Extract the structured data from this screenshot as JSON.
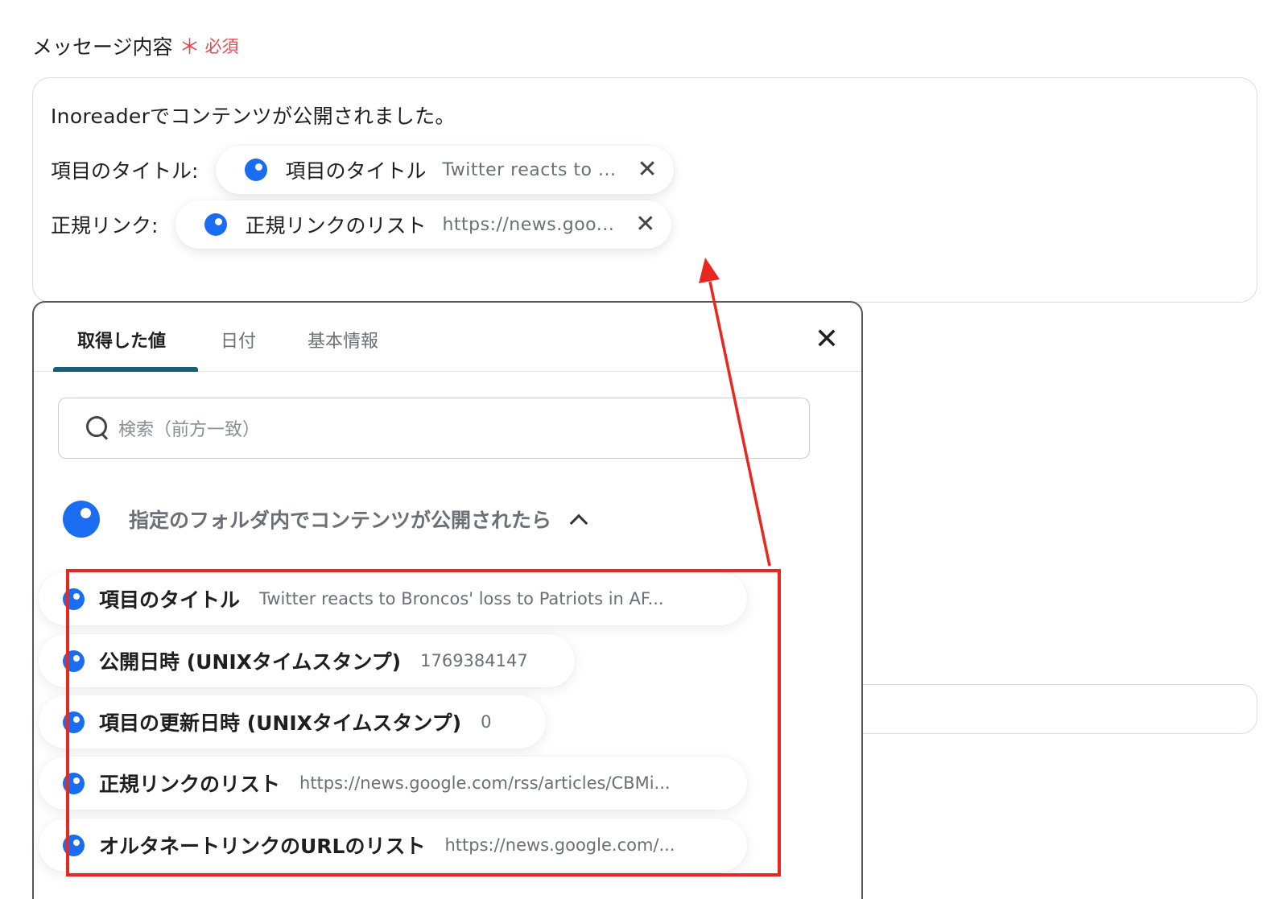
{
  "field": {
    "label": "メッセージ内容",
    "required_star": "＊",
    "required_text": "必須"
  },
  "message": {
    "line1": "Inoreaderでコンテンツが公開されました。",
    "rows": [
      {
        "label": "項目のタイトル:",
        "chip_name": "項目のタイトル",
        "chip_value": "Twitter reacts to ..."
      },
      {
        "label": "正規リンク:",
        "chip_name": "正規リンクのリスト",
        "chip_value": "https://news.goo..."
      }
    ]
  },
  "panel": {
    "tabs": [
      "取得した値",
      "日付",
      "基本情報"
    ],
    "active_tab": "取得した値",
    "search_placeholder": "検索（前方一致）",
    "section_title": "指定のフォルダ内でコンテンツが公開されたら",
    "items": [
      {
        "name": "項目のタイトル",
        "value": "Twitter reacts to Broncos' loss to Patriots in AF..."
      },
      {
        "name": "公開日時 (UNIXタイムスタンプ)",
        "value": "1769384147"
      },
      {
        "name": "項目の更新日時 (UNIXタイムスタンプ)",
        "value": "0"
      },
      {
        "name": "正規リンクのリスト",
        "value": "https://news.google.com/rss/articles/CBMi..."
      },
      {
        "name": "オルタネートリンクのURLのリスト",
        "value": "https://news.google.com/..."
      }
    ]
  },
  "icons": {
    "chip_remove": "close-icon",
    "panel_close": "close-icon",
    "search": "search-icon",
    "section_toggle": "chevron-up-icon"
  },
  "colors": {
    "accent_dot": "#1a6cf0",
    "required": "#e8464f",
    "annotation": "#e8281e",
    "tab_underline": "#1a5f78"
  }
}
